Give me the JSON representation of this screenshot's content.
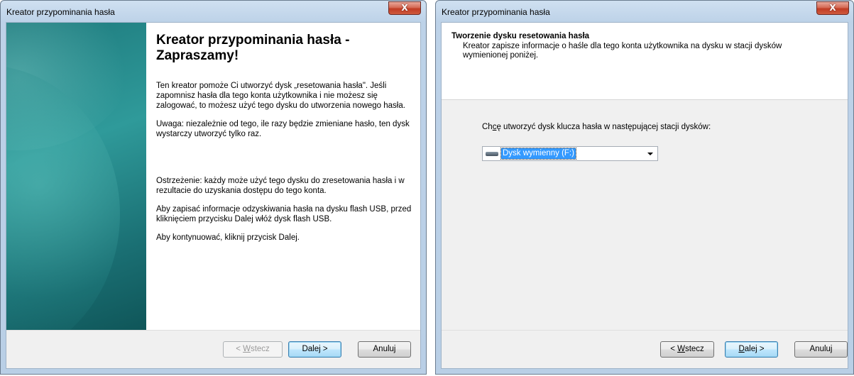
{
  "window1": {
    "title": "Kreator przypominania hasła",
    "close_label": "X",
    "heading": "Kreator przypominania hasła - Zapraszamy!",
    "paragraphs": [
      "Ten kreator pomoże Ci utworzyć dysk „resetowania hasła\". Jeśli zapomnisz hasła dla tego konta użytkownika i nie możesz się zalogować, to możesz użyć tego dysku do utworzenia nowego hasła.",
      "Uwaga: niezależnie od tego, ile razy będzie zmieniane hasło, ten dysk wystarczy utworzyć tylko raz.",
      "Ostrzeżenie: każdy może użyć tego dysku do zresetowania hasła i w rezultacie do uzyskania dostępu do tego konta.",
      "Aby zapisać informacje odzyskiwania hasła na dysku flash USB, przed kliknięciem przycisku Dalej włóż dysk flash USB.",
      "Aby kontynuować, kliknij przycisk Dalej."
    ],
    "buttons": {
      "back_prefix": "< ",
      "back_key": "W",
      "back_rest": "stecz",
      "next": "Dalej >",
      "cancel": "Anuluj"
    }
  },
  "window2": {
    "title": "Kreator przypominania hasła",
    "close_label": "X",
    "header_title": "Tworzenie dysku resetowania hasła",
    "header_subtitle": "Kreator zapisze informacje o haśle dla tego konta użytkownika na dysku w stacji dysków wymienionej poniżej.",
    "prompt_pre": "Ch",
    "prompt_key": "c",
    "prompt_post": "ę utworzyć dysk klucza hasła w następującej stacji dysków:",
    "drive_selected": "Dysk wymienny (F:)",
    "buttons": {
      "back_prefix": "< ",
      "back_key": "W",
      "back_rest": "stecz",
      "next_key": "D",
      "next_rest": "alej >",
      "cancel": "Anuluj"
    }
  }
}
